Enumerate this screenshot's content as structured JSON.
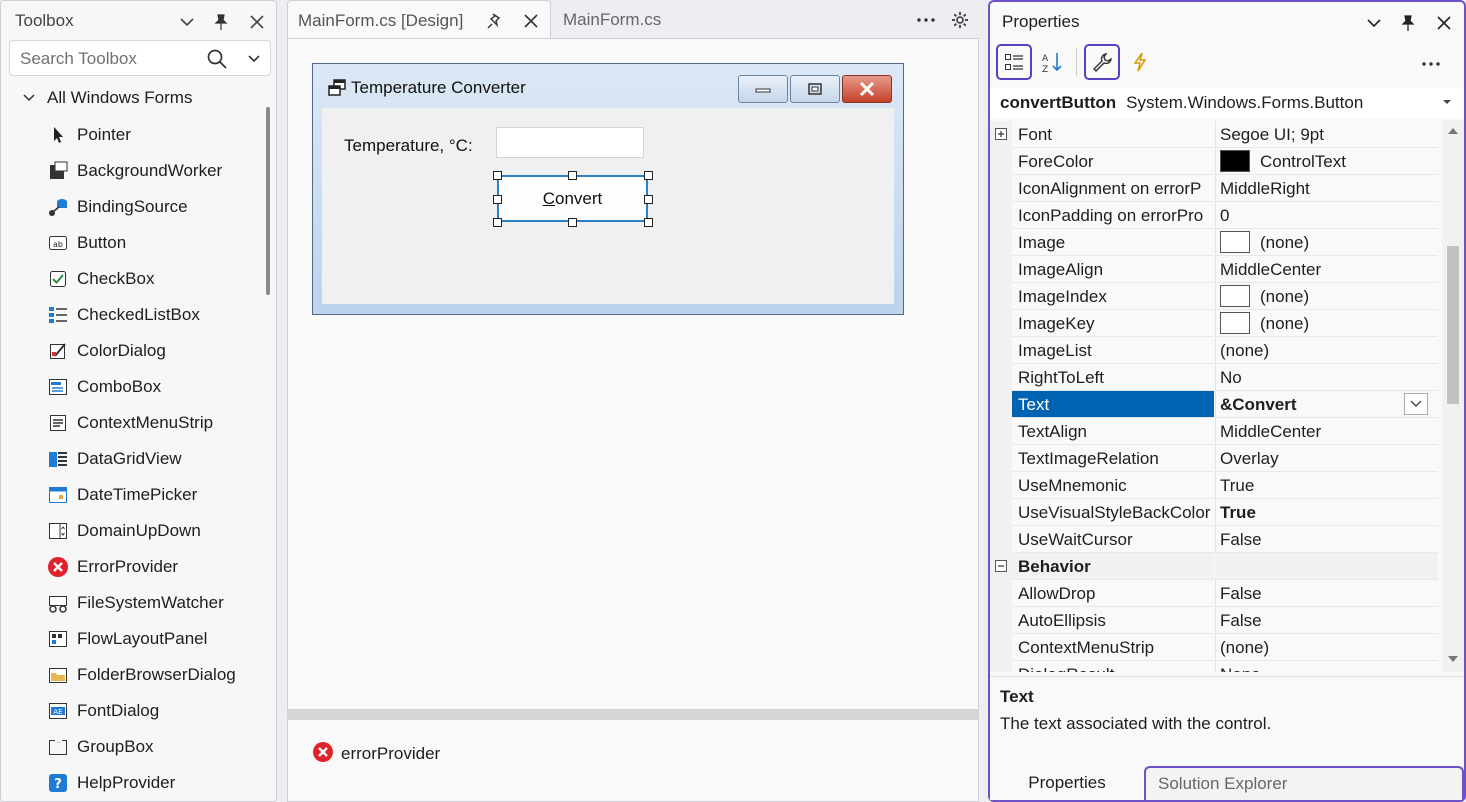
{
  "toolbox": {
    "title": "Toolbox",
    "search_placeholder": "Search Toolbox",
    "group_label": "All Windows Forms",
    "items": [
      {
        "label": "Pointer",
        "icon": "pointer-icon"
      },
      {
        "label": "BackgroundWorker",
        "icon": "backgroundworker-icon"
      },
      {
        "label": "BindingSource",
        "icon": "bindingsource-icon"
      },
      {
        "label": "Button",
        "icon": "button-icon"
      },
      {
        "label": "CheckBox",
        "icon": "checkbox-icon"
      },
      {
        "label": "CheckedListBox",
        "icon": "checkedlistbox-icon"
      },
      {
        "label": "ColorDialog",
        "icon": "colordialog-icon"
      },
      {
        "label": "ComboBox",
        "icon": "combobox-icon"
      },
      {
        "label": "ContextMenuStrip",
        "icon": "contextmenustrip-icon"
      },
      {
        "label": "DataGridView",
        "icon": "datagridview-icon"
      },
      {
        "label": "DateTimePicker",
        "icon": "datetimepicker-icon"
      },
      {
        "label": "DomainUpDown",
        "icon": "domainupdown-icon"
      },
      {
        "label": "ErrorProvider",
        "icon": "errorprovider-icon"
      },
      {
        "label": "FileSystemWatcher",
        "icon": "filesystemwatcher-icon"
      },
      {
        "label": "FlowLayoutPanel",
        "icon": "flowlayoutpanel-icon"
      },
      {
        "label": "FolderBrowserDialog",
        "icon": "folderbrowserdialog-icon"
      },
      {
        "label": "FontDialog",
        "icon": "fontdialog-icon"
      },
      {
        "label": "GroupBox",
        "icon": "groupbox-icon"
      },
      {
        "label": "HelpProvider",
        "icon": "helpprovider-icon"
      }
    ]
  },
  "editor": {
    "tabs": [
      {
        "label": "MainForm.cs [Design]"
      },
      {
        "label": "MainForm.cs"
      }
    ],
    "form": {
      "title": "Temperature Converter",
      "label": "Temperature, °C:",
      "input_value": "",
      "button_text_pre": "",
      "button_text_mnemonic": "C",
      "button_text_post": "onvert"
    },
    "tray": {
      "component": "errorProvider"
    }
  },
  "properties": {
    "title": "Properties",
    "object_name": "convertButton",
    "object_type": "System.Windows.Forms.Button",
    "rows": [
      {
        "name": "Font",
        "value": "Segoe UI; 9pt",
        "expand": true
      },
      {
        "name": "ForeColor",
        "value": "ControlText",
        "swatch": "#000000"
      },
      {
        "name": "IconAlignment on errorP",
        "value": "MiddleRight"
      },
      {
        "name": "IconPadding on errorPro",
        "value": "0"
      },
      {
        "name": "Image",
        "value": "(none)",
        "swatch": "#ffffff"
      },
      {
        "name": "ImageAlign",
        "value": "MiddleCenter"
      },
      {
        "name": "ImageIndex",
        "value": "(none)",
        "swatch": "#ffffff"
      },
      {
        "name": "ImageKey",
        "value": "(none)",
        "swatch": "#ffffff"
      },
      {
        "name": "ImageList",
        "value": "(none)"
      },
      {
        "name": "RightToLeft",
        "value": "No"
      },
      {
        "name": "Text",
        "value": "&Convert",
        "bold": true,
        "selected": true
      },
      {
        "name": "TextAlign",
        "value": "MiddleCenter"
      },
      {
        "name": "TextImageRelation",
        "value": "Overlay"
      },
      {
        "name": "UseMnemonic",
        "value": "True"
      },
      {
        "name": "UseVisualStyleBackColor",
        "value": "True",
        "bold": true
      },
      {
        "name": "UseWaitCursor",
        "value": "False"
      },
      {
        "name": "Behavior",
        "value": "",
        "category": true
      },
      {
        "name": "AllowDrop",
        "value": "False"
      },
      {
        "name": "AutoEllipsis",
        "value": "False"
      },
      {
        "name": "ContextMenuStrip",
        "value": "(none)"
      },
      {
        "name": "DialogResult",
        "value": "None"
      }
    ],
    "description": {
      "title": "Text",
      "text": "The text associated with the control."
    },
    "bottom_tabs": [
      {
        "label": "Properties"
      },
      {
        "label": "Solution Explorer"
      }
    ],
    "colors": {
      "accent": "#6e52c7",
      "selection": "#0063b1"
    }
  }
}
